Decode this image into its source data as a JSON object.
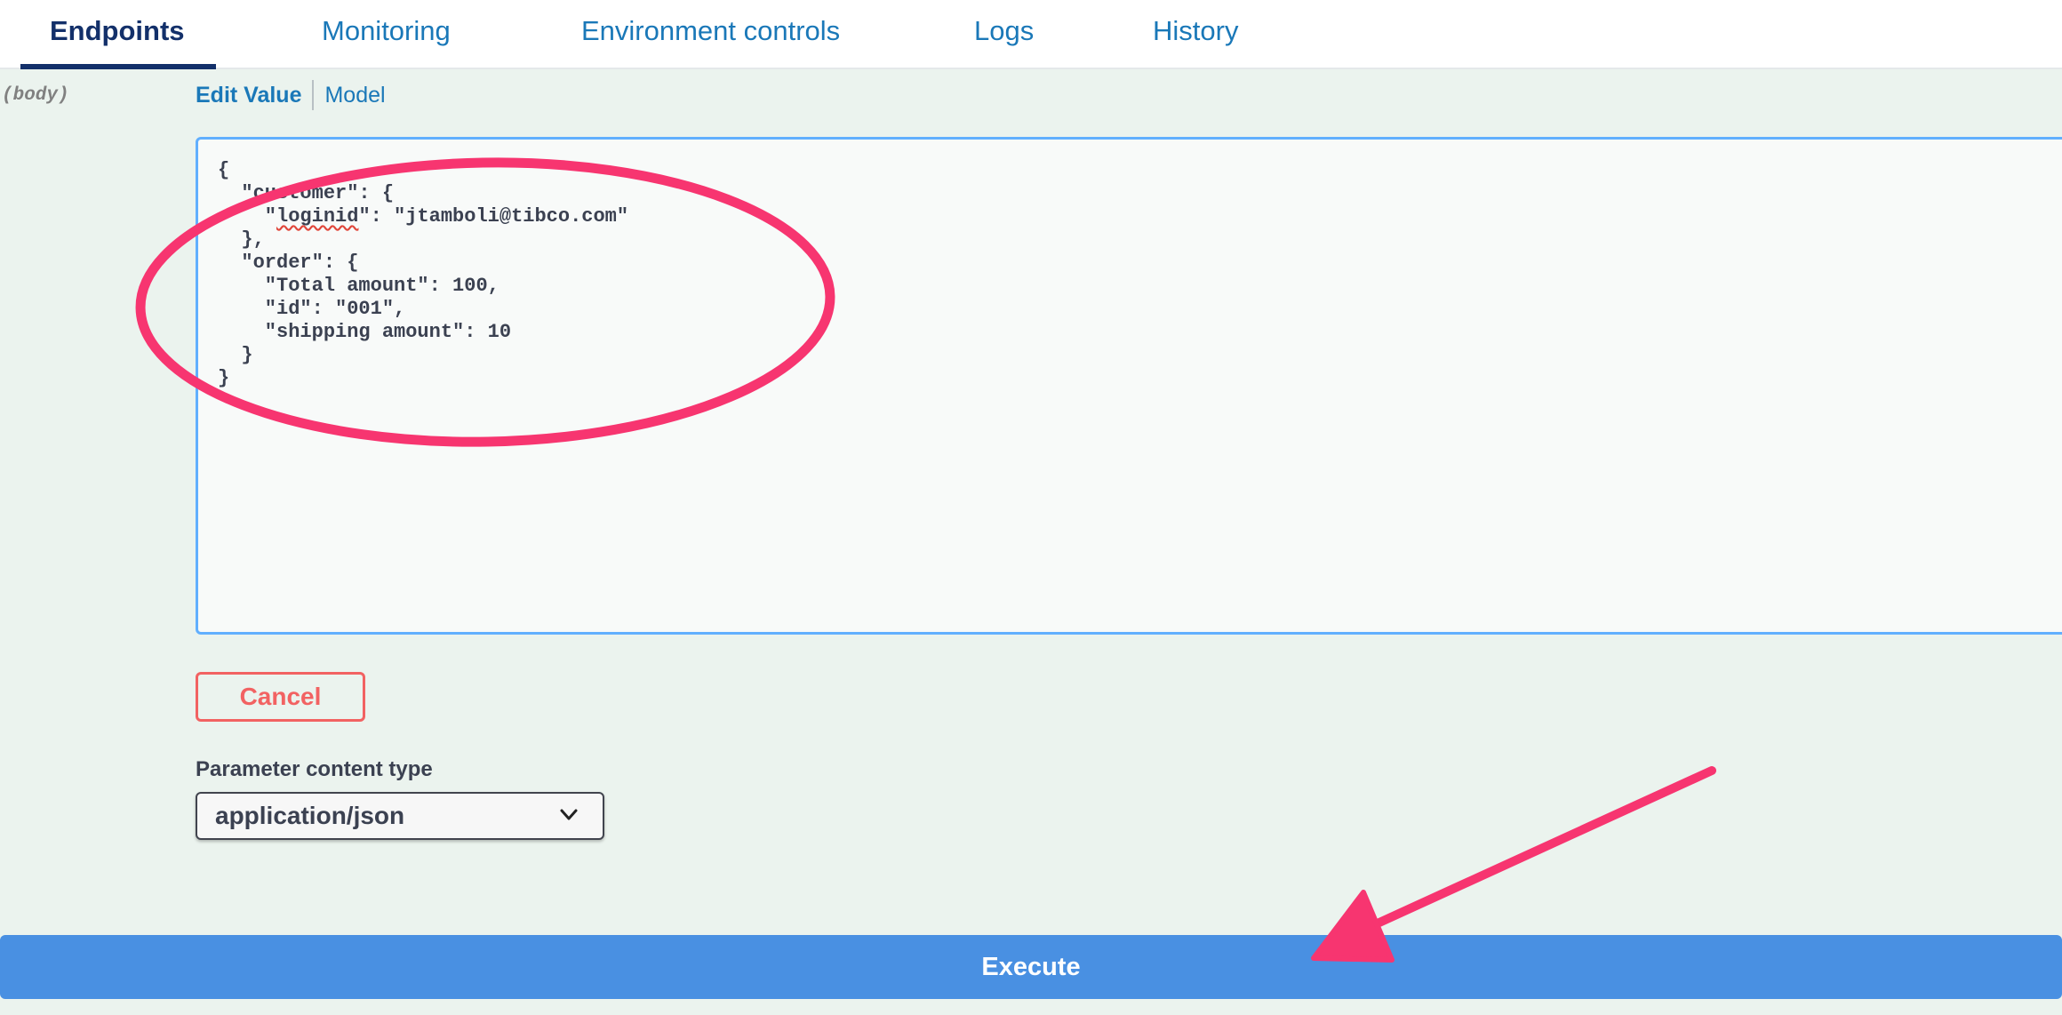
{
  "tabs": [
    {
      "label": "Endpoints",
      "active": true
    },
    {
      "label": "Monitoring",
      "active": false
    },
    {
      "label": "Environment controls",
      "active": false
    },
    {
      "label": "Logs",
      "active": false
    },
    {
      "label": "History",
      "active": false
    }
  ],
  "parameter": {
    "name": "(body)",
    "subtabs": {
      "edit_value": "Edit Value",
      "model": "Model"
    },
    "body_lines": [
      "{",
      "  \"customer\": {",
      "    \"loginid\": \"jtamboli@tibco.com\"",
      "  },",
      "  \"order\": {",
      "    \"Total amount\": 100,",
      "    \"id\": \"001\",",
      "    \"shipping amount\": 10",
      "  }",
      "}"
    ]
  },
  "cancel_label": "Cancel",
  "content_type": {
    "label": "Parameter content type",
    "selected": "application/json"
  },
  "execute_label": "Execute",
  "colors": {
    "accent": "#1a78b8",
    "active_tab": "#13306a",
    "execute": "#4990e2",
    "cancel": "#f26262",
    "annotation": "#f73570"
  }
}
